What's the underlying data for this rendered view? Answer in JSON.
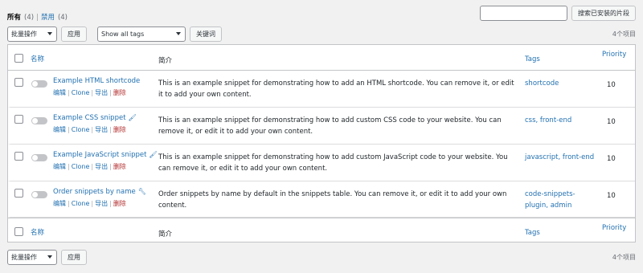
{
  "status_links": {
    "all_label": "所有",
    "all_count": "(4)",
    "disabled_label": "禁用",
    "disabled_count": "(4)"
  },
  "search": {
    "value": "",
    "button_label": "搜索已安装的片段"
  },
  "tablenav_top": {
    "bulk_select": "批量操作",
    "apply_label": "应用",
    "tags_select": "Show all tags",
    "filter_label": "关键词",
    "items_count": "4个项目"
  },
  "tablenav_bottom": {
    "bulk_select": "批量操作",
    "apply_label": "应用",
    "items_count": "4个项目"
  },
  "columns": {
    "name": "名称",
    "description": "简介",
    "tags": "Tags",
    "priority": "Priority"
  },
  "row_actions": {
    "edit": "编辑",
    "clone": "Clone",
    "export": "导出",
    "delete": "删除"
  },
  "snippets": [
    {
      "name": "Example HTML shortcode",
      "icon": "",
      "description": "This is an example snippet for demonstrating how to add an HTML shortcode. You can remove it, or edit it to add your own content.",
      "tags": "shortcode",
      "priority": "10"
    },
    {
      "name": "Example CSS snippet",
      "icon": "paintbrush-icon",
      "description": "This is an example snippet for demonstrating how to add custom CSS code to your website. You can remove it, or edit it to add your own content.",
      "tags": "css, front-end",
      "priority": "10"
    },
    {
      "name": "Example JavaScript snippet",
      "icon": "paintbrush-icon",
      "description": "This is an example snippet for demonstrating how to add custom JavaScript code to your website. You can remove it, or edit it to add your own content.",
      "tags": "javascript, front-end",
      "priority": "10"
    },
    {
      "name": "Order snippets by name",
      "icon": "wrench-icon",
      "description": "Order snippets by name by default in the snippets table. You can remove it, or edit it to add your own content.",
      "tags": "code-snippets-plugin, admin",
      "priority": "10"
    }
  ],
  "colors": {
    "link": "#2271b1",
    "delete": "#b32d2e",
    "background": "#f1f1f1"
  }
}
